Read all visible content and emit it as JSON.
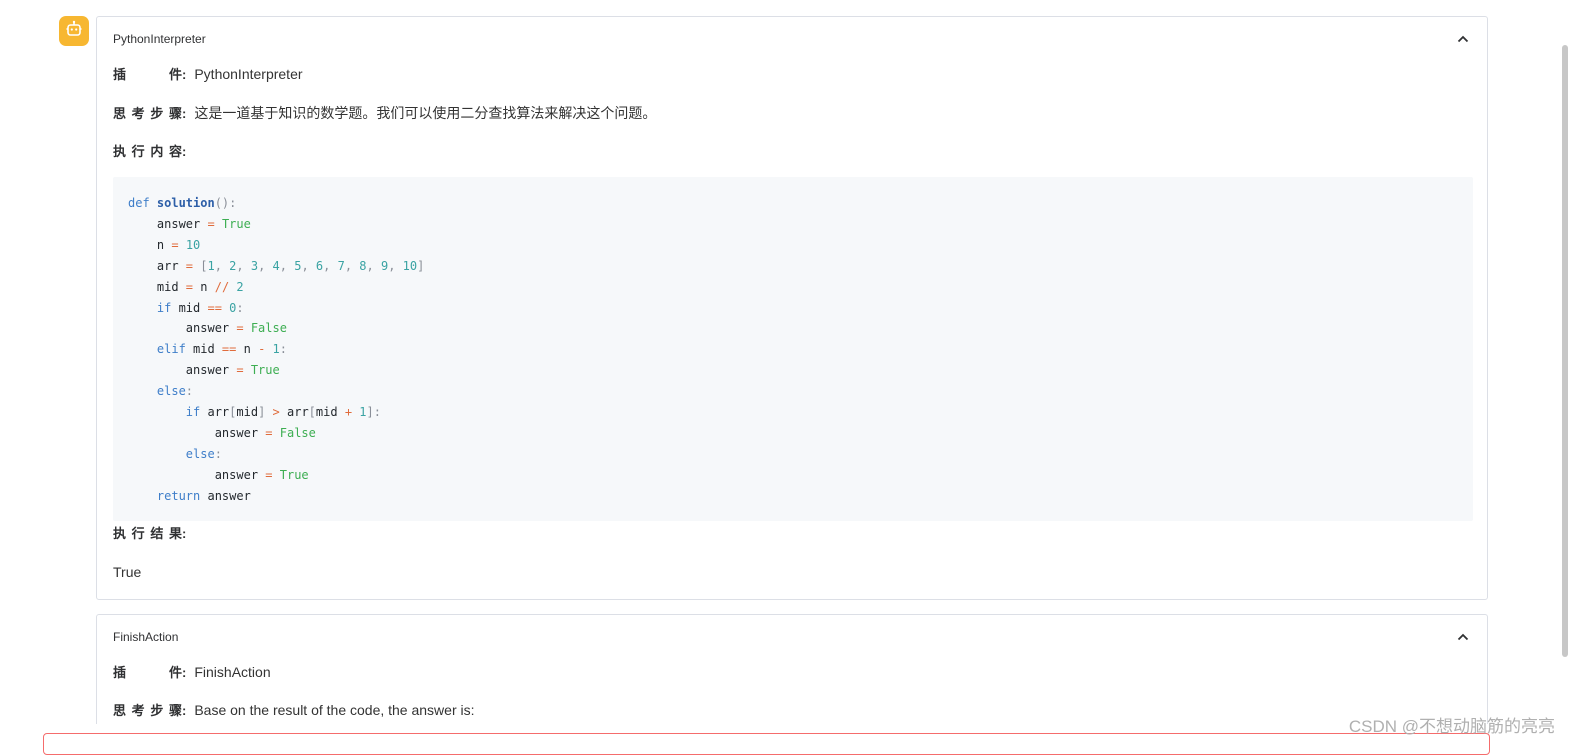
{
  "avatar": {
    "icon": "robot-icon",
    "color": "#f7b731"
  },
  "steps": [
    {
      "title": "PythonInterpreter",
      "plugin_label_chars": [
        "插",
        "件"
      ],
      "plugin_value": "PythonInterpreter",
      "thought_label_chars": [
        "思",
        "考",
        "步",
        "骤"
      ],
      "thought_value": "这是一道基于知识的数学题。我们可以使用二分查找算法来解决这个问题。",
      "exec_label_chars": [
        "执",
        "行",
        "内",
        "容"
      ],
      "result_label_chars": [
        "执",
        "行",
        "结",
        "果"
      ],
      "result_value": "True"
    },
    {
      "title": "FinishAction",
      "plugin_label_chars": [
        "插",
        "件"
      ],
      "plugin_value": "FinishAction",
      "thought_label_chars": [
        "思",
        "考",
        "步",
        "骤"
      ],
      "thought_value": "Base on the result of the code, the answer is:"
    }
  ],
  "colon": ":",
  "code": [
    [
      [
        "kw",
        "def "
      ],
      [
        "fn",
        "solution"
      ],
      [
        "pun",
        "():"
      ]
    ],
    [
      [
        "",
        "    answer "
      ],
      [
        "op",
        "="
      ],
      [
        "bool",
        " True"
      ]
    ],
    [
      [
        "",
        "    n "
      ],
      [
        "op",
        "="
      ],
      [
        "num",
        " 10"
      ]
    ],
    [
      [
        "",
        "    arr "
      ],
      [
        "op",
        "="
      ],
      [
        "pun",
        " ["
      ],
      [
        "num",
        "1"
      ],
      [
        "pun",
        ", "
      ],
      [
        "num",
        "2"
      ],
      [
        "pun",
        ", "
      ],
      [
        "num",
        "3"
      ],
      [
        "pun",
        ", "
      ],
      [
        "num",
        "4"
      ],
      [
        "pun",
        ", "
      ],
      [
        "num",
        "5"
      ],
      [
        "pun",
        ", "
      ],
      [
        "num",
        "6"
      ],
      [
        "pun",
        ", "
      ],
      [
        "num",
        "7"
      ],
      [
        "pun",
        ", "
      ],
      [
        "num",
        "8"
      ],
      [
        "pun",
        ", "
      ],
      [
        "num",
        "9"
      ],
      [
        "pun",
        ", "
      ],
      [
        "num",
        "10"
      ],
      [
        "pun",
        "]"
      ]
    ],
    [
      [
        "",
        "    mid "
      ],
      [
        "op",
        "="
      ],
      [
        "",
        " n "
      ],
      [
        "op",
        "//"
      ],
      [
        "num",
        " 2"
      ]
    ],
    [
      [
        "kw",
        "    if"
      ],
      [
        "",
        " mid "
      ],
      [
        "op",
        "=="
      ],
      [
        "num",
        " 0"
      ],
      [
        "pun",
        ":"
      ]
    ],
    [
      [
        "",
        "        answer "
      ],
      [
        "op",
        "="
      ],
      [
        "bool",
        " False"
      ]
    ],
    [
      [
        "kw",
        "    elif"
      ],
      [
        "",
        " mid "
      ],
      [
        "op",
        "=="
      ],
      [
        "",
        " n "
      ],
      [
        "op",
        "-"
      ],
      [
        "num",
        " 1"
      ],
      [
        "pun",
        ":"
      ]
    ],
    [
      [
        "",
        "        answer "
      ],
      [
        "op",
        "="
      ],
      [
        "bool",
        " True"
      ]
    ],
    [
      [
        "kw",
        "    else"
      ],
      [
        "pun",
        ":"
      ]
    ],
    [
      [
        "kw",
        "        if"
      ],
      [
        "",
        " arr"
      ],
      [
        "pun",
        "["
      ],
      [
        "",
        "mid"
      ],
      [
        "pun",
        "]"
      ],
      [
        "op",
        " >"
      ],
      [
        "",
        " arr"
      ],
      [
        "pun",
        "["
      ],
      [
        "",
        "mid "
      ],
      [
        "op",
        "+"
      ],
      [
        "num",
        " 1"
      ],
      [
        "pun",
        "]:"
      ]
    ],
    [
      [
        "",
        "            answer "
      ],
      [
        "op",
        "="
      ],
      [
        "bool",
        " False"
      ]
    ],
    [
      [
        "kw",
        "        else"
      ],
      [
        "pun",
        ":"
      ]
    ],
    [
      [
        "",
        "            answer "
      ],
      [
        "op",
        "="
      ],
      [
        "bool",
        " True"
      ]
    ],
    [
      [
        "kw",
        "    return"
      ],
      [
        "",
        " answer"
      ]
    ]
  ],
  "watermark": "CSDN @不想动脑筋的亮亮",
  "colors": {
    "keyword": "#3e7ec9",
    "number": "#3aa3a3",
    "operator": "#e06c3c",
    "boolean": "#3dae52",
    "error_border": "#f56c6c"
  }
}
